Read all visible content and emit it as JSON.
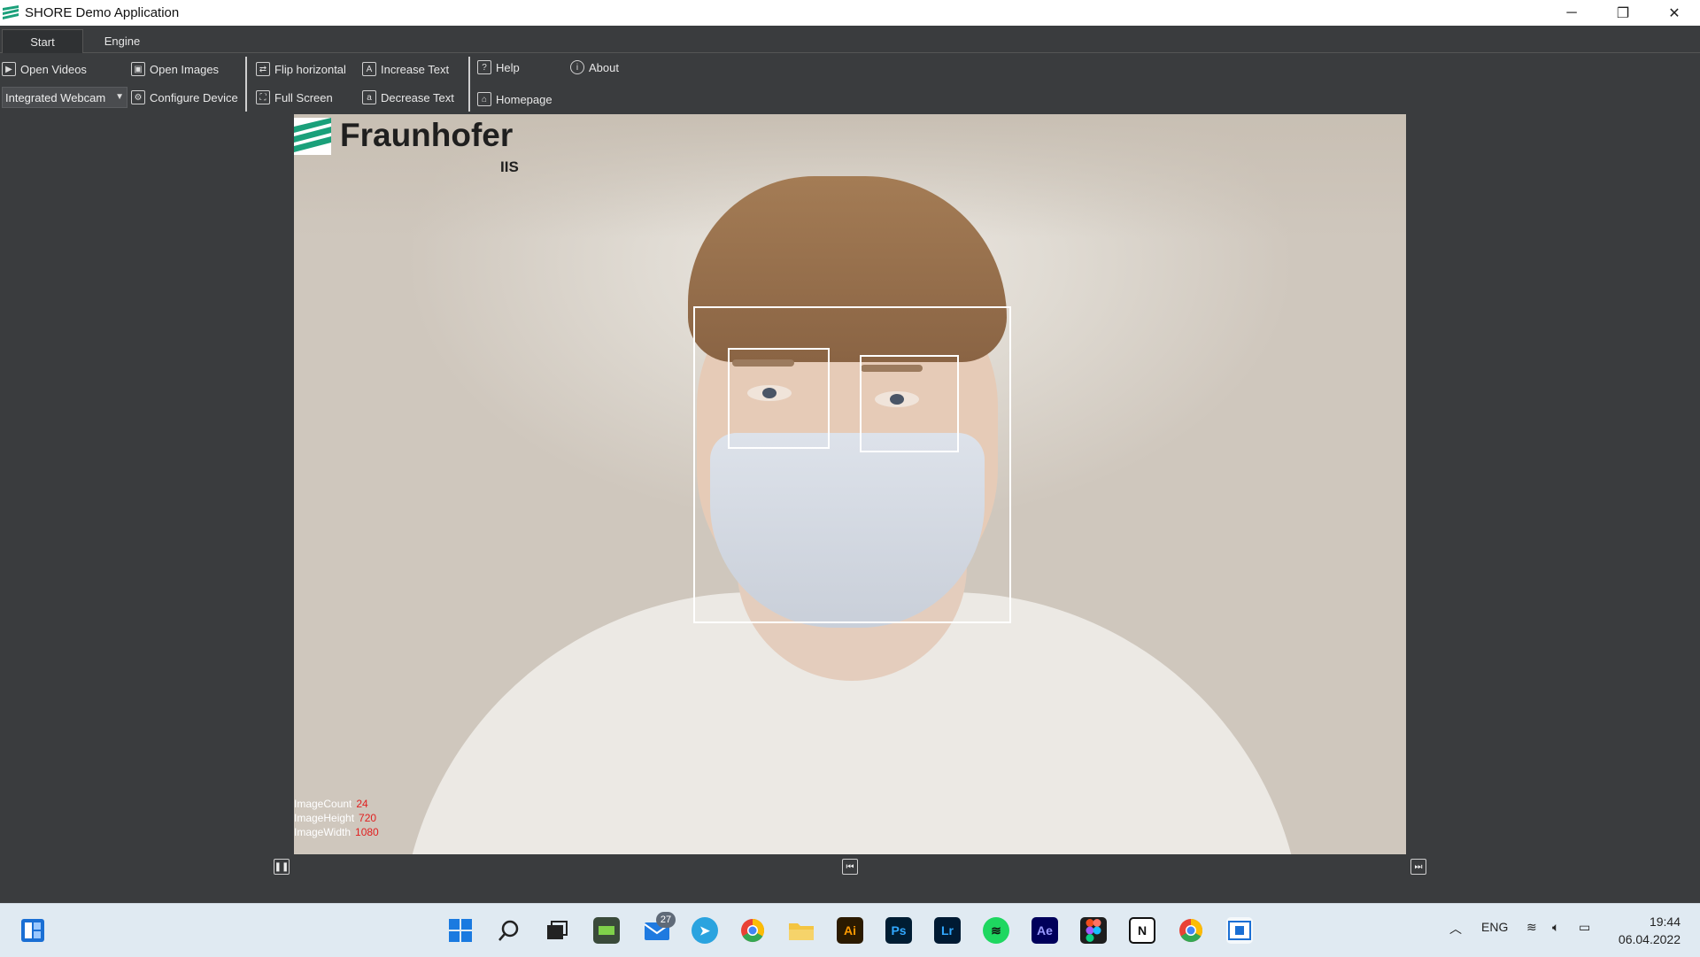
{
  "window": {
    "title": "SHORE Demo Application",
    "minimize": "─",
    "restore": "❐",
    "close": "✕"
  },
  "tabs": [
    {
      "label": "Start",
      "active": true
    },
    {
      "label": "Engine",
      "active": false
    }
  ],
  "ribbon": {
    "open_videos": "Open Videos",
    "open_images": "Open Images",
    "flip_horizontal": "Flip horizontal",
    "increase_text": "Increase Text",
    "help": "Help",
    "about": "About",
    "source_select": "Integrated Webcam",
    "configure_device": "Configure Device",
    "full_screen": "Full Screen",
    "decrease_text": "Decrease Text",
    "homepage": "Homepage"
  },
  "viewer": {
    "logo_text": "Fraunhofer",
    "logo_subtext": "IIS",
    "stats": [
      {
        "key": "ImageCount",
        "value": "24"
      },
      {
        "key": "ImageHeight",
        "value": "720"
      },
      {
        "key": "ImageWidth",
        "value": "1080"
      }
    ]
  },
  "playback": {
    "pause_icon": "pause-icon",
    "prev_icon": "skip-back-icon",
    "next_icon": "skip-forward-icon"
  },
  "taskbar": {
    "mail_badge": "27",
    "apps": [
      "start",
      "search",
      "task-view",
      "app-green",
      "mail",
      "telegram",
      "chrome",
      "file-explorer",
      "illustrator",
      "photoshop",
      "lightroom",
      "spotify",
      "after-effects",
      "figma",
      "notion",
      "chrome-2",
      "shore-app"
    ],
    "illustrator_label": "Ai",
    "photoshop_label": "Ps",
    "lightroom_label": "Lr",
    "after_effects_label": "Ae",
    "notion_label": "N",
    "language": "ENG",
    "time": "19:44",
    "date": "06.04.2022"
  },
  "colors": {
    "accent": "#1aa07a",
    "stats_value": "#e02020",
    "toolbar_bg": "#3a3c3e"
  }
}
